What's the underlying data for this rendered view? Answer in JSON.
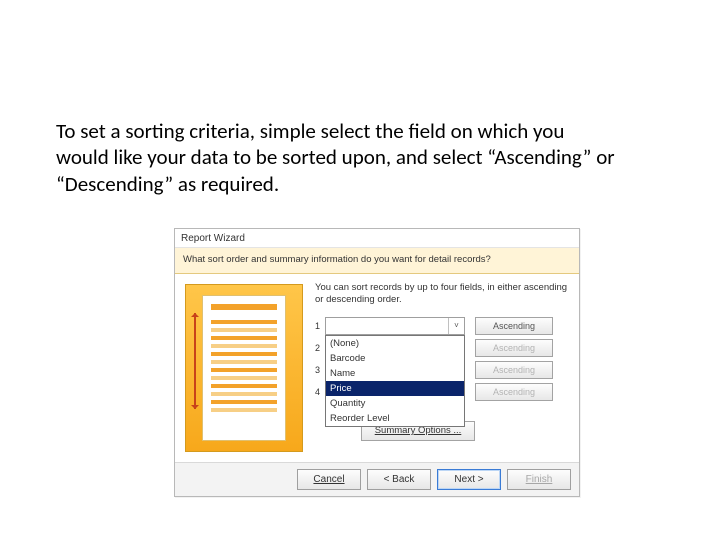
{
  "caption": "To set a sorting criteria, simple select the field on which you would like your data to be sorted upon, and select “Ascending” or “Descending” as required.",
  "dialog": {
    "title": "Report Wizard",
    "prompt": "What sort order and summary information do you want for detail records?",
    "hint": "You can sort records by up to four fields, in either ascending or descending order.",
    "rows": [
      {
        "num": "1",
        "asc": "Ascending",
        "dim": false
      },
      {
        "num": "2",
        "asc": "Ascending",
        "dim": true
      },
      {
        "num": "3",
        "asc": "Ascending",
        "dim": true
      },
      {
        "num": "4",
        "asc": "Ascending",
        "dim": true
      }
    ],
    "dropdown": {
      "options": [
        "(None)",
        "Barcode",
        "Name",
        "Price",
        "Quantity",
        "Reorder Level"
      ],
      "selected": "Price"
    },
    "summary": "Summary Options ...",
    "buttons": {
      "cancel": "Cancel",
      "back": "< Back",
      "next": "Next >",
      "finish": "Finish"
    }
  }
}
